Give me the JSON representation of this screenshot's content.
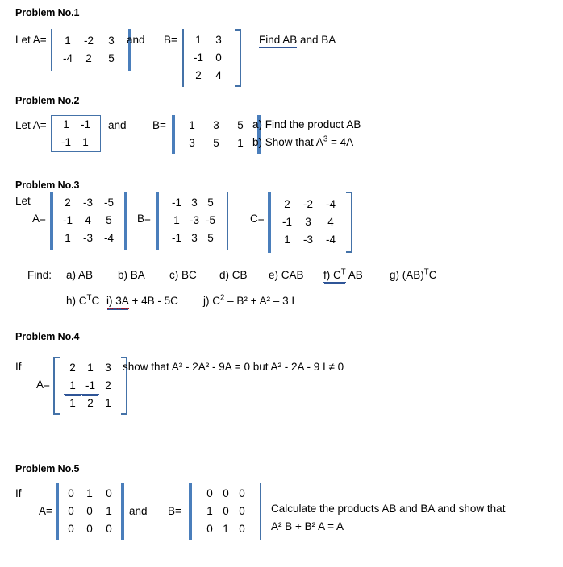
{
  "document": {
    "type": "matrix-algebra-problem-set"
  },
  "problem1": {
    "heading": "Problem No.1",
    "let_label": "Let A=",
    "matrixA": {
      "rows": [
        [
          "1",
          "-2",
          "3"
        ],
        [
          "-4",
          "2",
          "5"
        ]
      ]
    },
    "and_label": "and",
    "b_label": "B=",
    "matrixB": {
      "rows": [
        [
          "1",
          "3"
        ],
        [
          "-1",
          "0"
        ],
        [
          "2",
          "4"
        ]
      ]
    },
    "task_underlined": "Find  AB",
    "task_rest": " and  BA"
  },
  "problem2": {
    "heading": "Problem No.2",
    "let_label": "Let A=",
    "matrixA": {
      "rows": [
        [
          "1",
          "-1"
        ],
        [
          "-1",
          "1"
        ]
      ]
    },
    "and_label": "and",
    "b_label": "B=",
    "matrixB": {
      "rows": [
        [
          "1",
          "3",
          "5"
        ],
        [
          "3",
          "5",
          "1"
        ]
      ]
    },
    "item_a": "a) Find the product AB",
    "item_b_pre": "b) Show that A",
    "item_b_sup": "3",
    "item_b_post": " = 4A"
  },
  "problem3": {
    "heading": "Problem No.3",
    "let_label": "Let",
    "a_label": "A=",
    "matrixA": {
      "rows": [
        [
          "2",
          "-3",
          "-5"
        ],
        [
          "-1",
          "4",
          "5"
        ],
        [
          "1",
          "-3",
          "-4"
        ]
      ]
    },
    "b_label": "B=",
    "matrixB": {
      "rows": [
        [
          "-1",
          "3",
          "5"
        ],
        [
          "1",
          "-3",
          "-5"
        ],
        [
          "-1",
          "3",
          "5"
        ]
      ]
    },
    "c_label": "C=",
    "matrixC": {
      "rows": [
        [
          "2",
          "-2",
          "-4"
        ],
        [
          "-1",
          "3",
          "4"
        ],
        [
          "1",
          "-3",
          "-4"
        ]
      ]
    },
    "find_label": "Find:",
    "items_row1": [
      {
        "text": "a) AB"
      },
      {
        "text": "b) BA"
      },
      {
        "text": "c) BC"
      },
      {
        "text": "d) CB"
      },
      {
        "text": "e) CAB"
      },
      {
        "text": "f) C",
        "sup": "T",
        "after": " AB",
        "underline": "double"
      },
      {
        "text": "g) (AB)",
        "sup": "T",
        "after": "C"
      }
    ],
    "items_row2": [
      {
        "text": "h) C",
        "sup": "T",
        "after": "C"
      },
      {
        "text": "i) 3A",
        "after": " + 4B  -  5C",
        "underline": "double",
        "squiggle": true
      },
      {
        "text": "j) C",
        "sup": "2",
        "after": " – B² + A² – 3 I"
      }
    ]
  },
  "problem4": {
    "heading": "Problem No.4",
    "if_label": "If",
    "a_label": "A=",
    "matrixA": {
      "rows": [
        [
          "2",
          "1",
          "3"
        ],
        [
          "1",
          "-1",
          "2"
        ],
        [
          "1",
          "2",
          "1"
        ]
      ]
    },
    "underlined_cells": "row2",
    "statement": "show that A³ - 2A² - 9A = 0 but A² - 2A - 9 I ≠ 0"
  },
  "problem5": {
    "heading": "Problem No.5",
    "if_label": "If",
    "a_label": "A=",
    "matrixA": {
      "rows": [
        [
          "0",
          "1",
          "0"
        ],
        [
          "0",
          "0",
          "1"
        ],
        [
          "0",
          "0",
          "0"
        ]
      ]
    },
    "and_label": "and",
    "b_label": "B=",
    "matrixB": {
      "rows": [
        [
          "0",
          "0",
          "0"
        ],
        [
          "1",
          "0",
          "0"
        ],
        [
          "0",
          "1",
          "0"
        ]
      ]
    },
    "task_line1": "Calculate the products AB and BA and show that",
    "task_line2": "A² B + B² A =  A"
  },
  "colors": {
    "matrix_bar": "#4472a8",
    "matrix_bar_thick": "#4a7ebb",
    "underline": "#2f5597",
    "squiggle": "#cc0000",
    "text": "#000000"
  }
}
